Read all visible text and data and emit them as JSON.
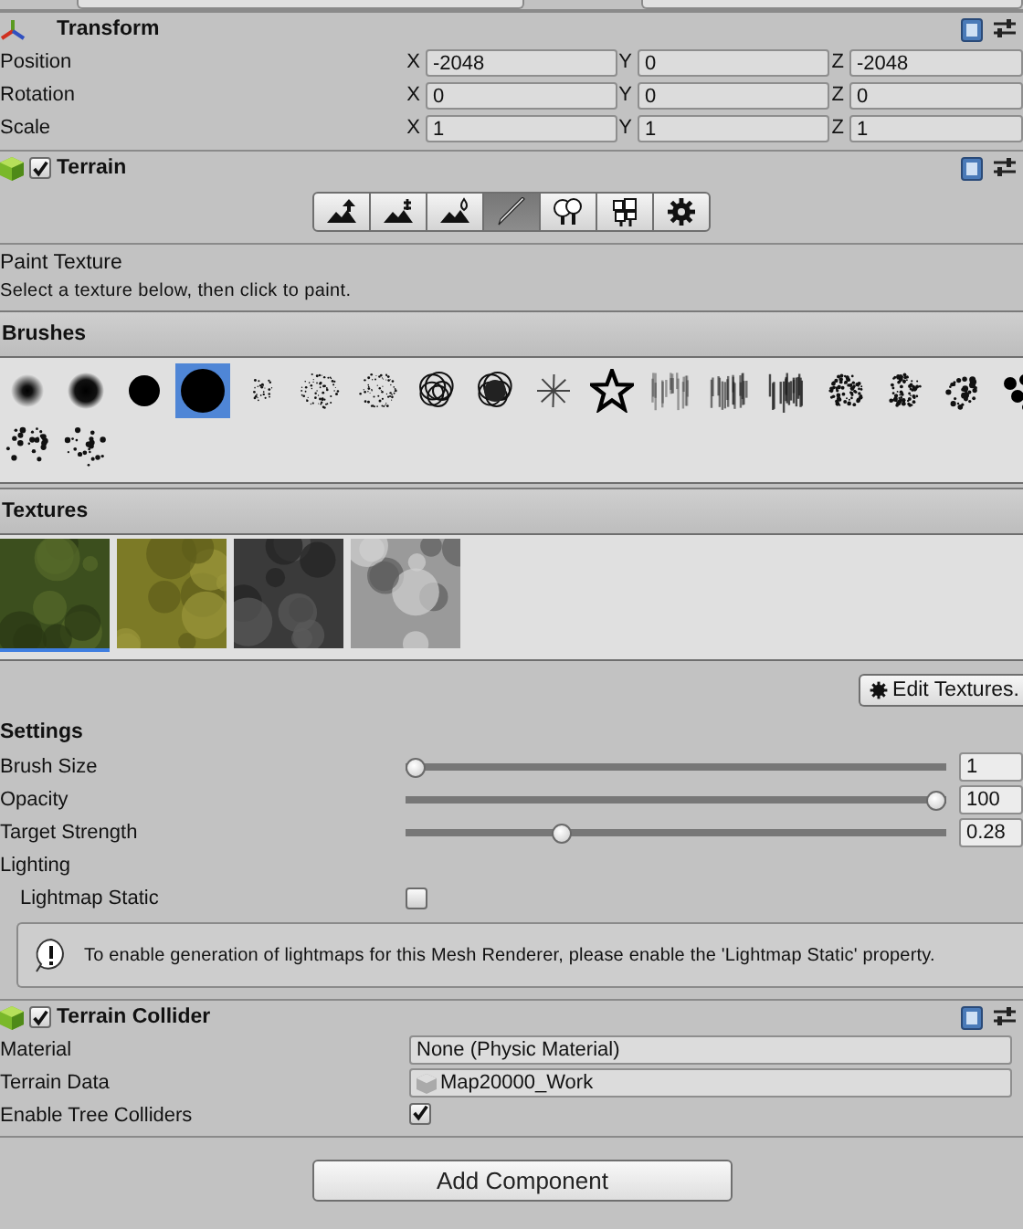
{
  "transform": {
    "title": "Transform",
    "rows": [
      {
        "label": "Position",
        "values": [
          {
            "axis": "X",
            "value": "-2048"
          },
          {
            "axis": "Y",
            "value": "0"
          },
          {
            "axis": "Z",
            "value": "-2048"
          }
        ]
      },
      {
        "label": "Rotation",
        "values": [
          {
            "axis": "X",
            "value": "0"
          },
          {
            "axis": "Y",
            "value": "0"
          },
          {
            "axis": "Z",
            "value": "0"
          }
        ]
      },
      {
        "label": "Scale",
        "values": [
          {
            "axis": "X",
            "value": "1"
          },
          {
            "axis": "Y",
            "value": "1"
          },
          {
            "axis": "Z",
            "value": "1"
          }
        ]
      }
    ]
  },
  "terrain": {
    "title": "Terrain",
    "enabled": true,
    "tools": [
      {
        "kind": "raise",
        "selected": false
      },
      {
        "kind": "stamp",
        "selected": false
      },
      {
        "kind": "smooth",
        "selected": false
      },
      {
        "kind": "paint",
        "selected": true
      },
      {
        "kind": "tree",
        "selected": false
      },
      {
        "kind": "detail",
        "selected": false
      },
      {
        "kind": "settings",
        "selected": false
      }
    ],
    "tool_title": "Paint Texture",
    "tool_hint": "Select a texture below, then click to paint.",
    "brushes_title": "Brushes",
    "brushes": [
      {
        "kind": "soft",
        "selected": false
      },
      {
        "kind": "soft",
        "selected": false
      },
      {
        "kind": "hard",
        "selected": false
      },
      {
        "kind": "hard",
        "selected": true
      },
      {
        "kind": "speckle",
        "selected": false
      },
      {
        "kind": "speckle",
        "selected": false
      },
      {
        "kind": "speckle",
        "selected": false
      },
      {
        "kind": "scribble",
        "selected": false
      },
      {
        "kind": "scribble",
        "selected": false
      },
      {
        "kind": "asterisk",
        "selected": false
      },
      {
        "kind": "star",
        "selected": false
      },
      {
        "kind": "streak",
        "selected": false
      },
      {
        "kind": "streak",
        "selected": false
      },
      {
        "kind": "streak",
        "selected": false
      },
      {
        "kind": "smudge",
        "selected": false
      },
      {
        "kind": "smudge",
        "selected": false
      },
      {
        "kind": "splat",
        "selected": false
      },
      {
        "kind": "dots",
        "selected": false
      },
      {
        "kind": "cluster",
        "selected": false
      },
      {
        "kind": "cluster",
        "selected": false
      }
    ],
    "textures_title": "Textures",
    "textures": [
      {
        "kind": "picture",
        "selected": true
      },
      {
        "kind": "picture",
        "selected": false
      },
      {
        "kind": "picture",
        "selected": false
      },
      {
        "kind": "picture",
        "selected": false
      }
    ],
    "edit_button": "Edit Textures.",
    "settings_title": "Settings",
    "sliders": [
      {
        "label": "Brush Size",
        "level": 0,
        "value": "1"
      },
      {
        "label": "Opacity",
        "level": 1,
        "value": "100"
      },
      {
        "label": "Target Strength",
        "level": 0.28,
        "value": "0.28"
      }
    ],
    "lighting_label": "Lighting",
    "lightmap_static": {
      "label": "Lightmap Static",
      "checked": false
    },
    "help": "To enable generation of lightmaps for this Mesh Renderer, please enable the 'Lightmap Static' property."
  },
  "terrain_collider": {
    "title": "Terrain Collider",
    "enabled": true,
    "rows": [
      {
        "kind": "object",
        "label": "Material",
        "value": "None (Physic Material)"
      },
      {
        "kind": "asset",
        "label": "Terrain Data",
        "value": "Map20000_Work"
      },
      {
        "kind": "checkbox",
        "label": "Enable Tree Colliders",
        "checked": true
      }
    ]
  },
  "add_component": "Add Component"
}
